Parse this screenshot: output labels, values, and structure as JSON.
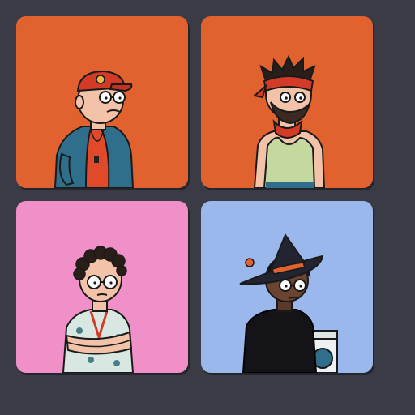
{
  "background_color": "#3a3b45",
  "cards": [
    {
      "icon": "old-man-red-cap-avatar",
      "background_color": "#e2622f"
    },
    {
      "icon": "man-red-bandana-avatar",
      "background_color": "#e2622f"
    },
    {
      "icon": "curly-hair-boy-avatar",
      "background_color": "#f08fc8"
    },
    {
      "icon": "witch-hat-avatar",
      "background_color": "#9bb8ec"
    }
  ]
}
